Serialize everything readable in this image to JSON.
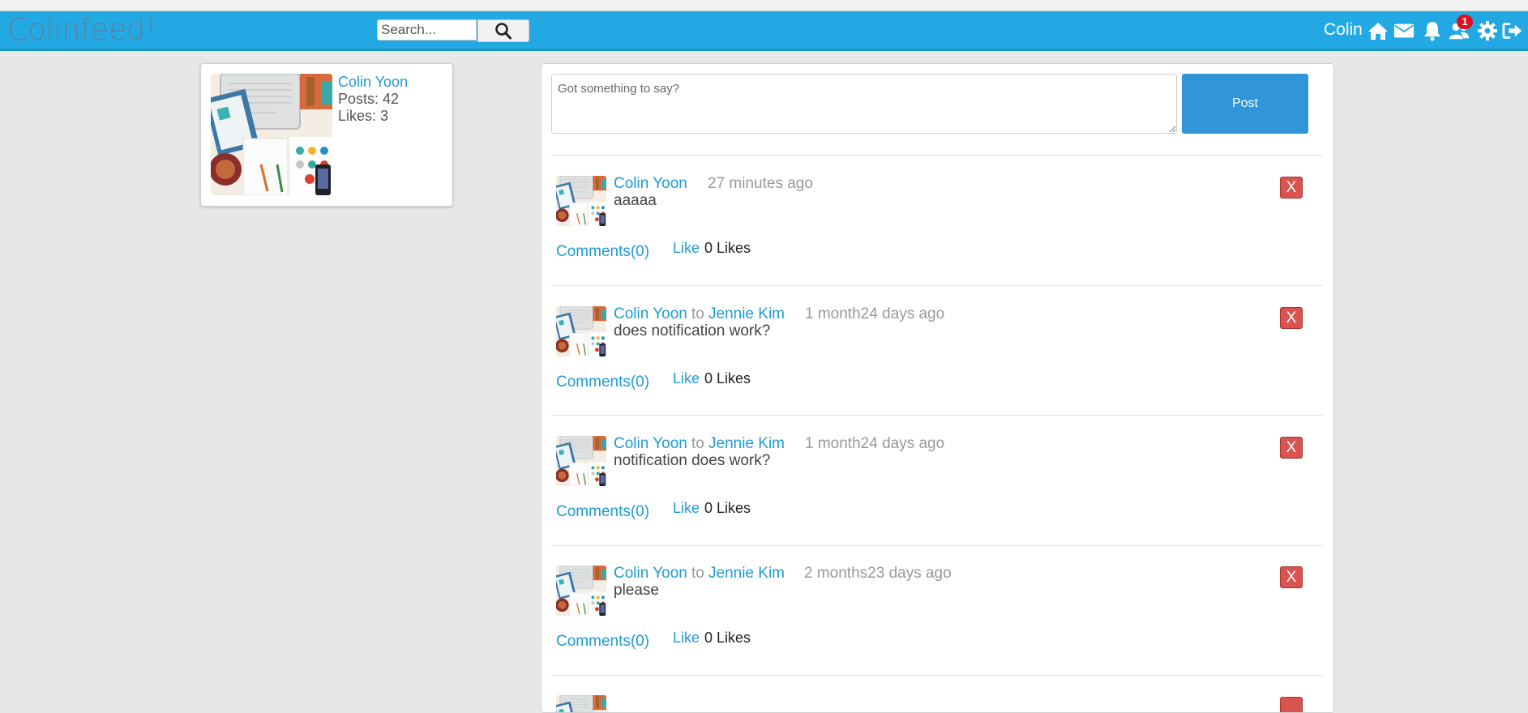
{
  "header": {
    "logo": "Colinfeed!",
    "search_placeholder": "Search...",
    "user_name": "Colin",
    "notification_count": "1",
    "icons": [
      "home-icon",
      "envelope-icon",
      "bell-icon",
      "users-icon",
      "gear-icon",
      "sign-out-icon"
    ]
  },
  "profile": {
    "name": "Colin Yoon",
    "posts": "Posts: 42",
    "likes": "Likes: 3"
  },
  "composer": {
    "placeholder": "Got something to say?",
    "post_label": "Post"
  },
  "posts": [
    {
      "author": "Colin Yoon",
      "to": "",
      "recipient": "",
      "time": "27 minutes ago",
      "body": "aaaaa",
      "delete": "X",
      "comments": "Comments(0)",
      "like": "Like",
      "likes": "0 Likes"
    },
    {
      "author": "Colin Yoon",
      "to": "to",
      "recipient": "Jennie Kim",
      "time": "1 month24 days ago",
      "body": "does notification work?",
      "delete": "X",
      "comments": "Comments(0)",
      "like": "Like",
      "likes": "0 Likes"
    },
    {
      "author": "Colin Yoon",
      "to": "to",
      "recipient": "Jennie Kim",
      "time": "1 month24 days ago",
      "body": "notification does work?",
      "delete": "X",
      "comments": "Comments(0)",
      "like": "Like",
      "likes": "0 Likes"
    },
    {
      "author": "Colin Yoon",
      "to": "to",
      "recipient": "Jennie Kim",
      "time": "2 months23 days ago",
      "body": "please",
      "delete": "X",
      "comments": "Comments(0)",
      "like": "Like",
      "likes": "0 Likes"
    }
  ],
  "colors": {
    "navbar": "#22a9e3",
    "link": "#1f9bd6",
    "post_button": "#3096d9",
    "delete_button": "#d9534f",
    "badge": "#e0101a"
  }
}
